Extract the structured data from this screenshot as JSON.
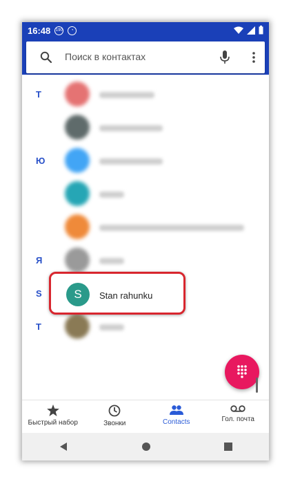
{
  "status_bar": {
    "time": "16:48",
    "badge_1": "190"
  },
  "search": {
    "placeholder": "Поиск в контактах"
  },
  "contacts": [
    {
      "letter": "Т",
      "avatar_color": "#e57373"
    },
    {
      "letter": "",
      "avatar_color": "#5f6b6b"
    },
    {
      "letter": "Ю",
      "avatar_color": "#42a5f5"
    },
    {
      "letter": "",
      "avatar_color": "#26a6b5"
    },
    {
      "letter": "",
      "avatar_color": "#ef8a3a"
    },
    {
      "letter": "Я",
      "avatar_color": "#9a9a9a"
    },
    {
      "letter": "S",
      "avatar_color": "#2a9a8a",
      "initial": "S",
      "name": "Stan rahunku",
      "highlighted": true
    },
    {
      "letter": "T",
      "avatar_color": "#8a7a55"
    }
  ],
  "bottom_nav": {
    "items": [
      {
        "label": "Быстрый набор",
        "icon": "star-icon"
      },
      {
        "label": "Звонки",
        "icon": "clock-icon"
      },
      {
        "label": "Contacts",
        "icon": "people-icon",
        "active": true
      },
      {
        "label": "Гол. почта",
        "icon": "voicemail-icon"
      }
    ]
  },
  "colors": {
    "header": "#1a40b8",
    "accent": "#2a5bd7",
    "fab": "#e8185f",
    "highlight_border": "#d8262e"
  }
}
